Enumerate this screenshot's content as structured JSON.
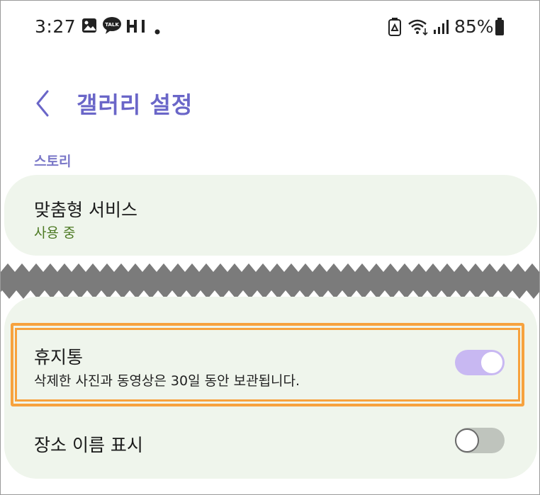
{
  "status_bar": {
    "time": "3:27",
    "talk_badge": "TALK",
    "battery_percent": "85%"
  },
  "header": {
    "title": "갤러리 설정"
  },
  "section": {
    "label": "스토리"
  },
  "items": [
    {
      "title": "맞춤형 서비스",
      "subtitle": "사용 중"
    },
    {
      "title": "휴지통",
      "subtitle": "삭제한 사진과 동영상은 30일 동안 보관됩니다.",
      "toggle": "on"
    },
    {
      "title": "장소 이름 표시",
      "toggle": "off"
    }
  ],
  "colors": {
    "accent": "#6a66c8",
    "card_bg": "#eff5ec",
    "subtitle_green": "#4d7a24",
    "highlight": "#f7a23e",
    "toggle_on": "#c8b8f2",
    "toggle_off": "#bfc4bd"
  }
}
